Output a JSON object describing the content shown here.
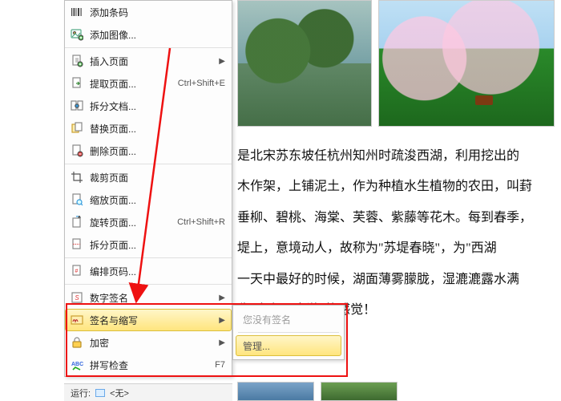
{
  "menu": {
    "items": [
      {
        "label": "添加条码",
        "icon": "barcode-icon"
      },
      {
        "label": "添加图像...",
        "icon": "image-add-icon"
      },
      {
        "sep": true
      },
      {
        "label": "插入页面",
        "icon": "page-insert-icon",
        "submenu": true
      },
      {
        "label": "提取页面...",
        "icon": "page-extract-icon",
        "shortcut": "Ctrl+Shift+E"
      },
      {
        "label": "拆分文档...",
        "icon": "doc-split-icon"
      },
      {
        "label": "替换页面...",
        "icon": "page-replace-icon"
      },
      {
        "label": "删除页面...",
        "icon": "page-delete-icon"
      },
      {
        "sep": true
      },
      {
        "label": "裁剪页面",
        "icon": "crop-icon"
      },
      {
        "label": "缩放页面...",
        "icon": "zoom-page-icon"
      },
      {
        "label": "旋转页面...",
        "icon": "rotate-icon",
        "shortcut": "Ctrl+Shift+R"
      },
      {
        "label": "拆分页面...",
        "icon": "split-page-icon"
      },
      {
        "sep": true
      },
      {
        "label": "编排页码...",
        "icon": "number-pages-icon"
      },
      {
        "sep": true
      },
      {
        "label": "数字签名",
        "icon": "digital-sign-icon",
        "submenu": true
      },
      {
        "label": "签名与缩写",
        "icon": "sign-initials-icon",
        "submenu": true,
        "active": true
      },
      {
        "label": "加密",
        "icon": "encrypt-icon",
        "submenu": true
      },
      {
        "label": "拼写检查",
        "icon": "spellcheck-icon",
        "shortcut": "F7"
      }
    ]
  },
  "submenu": {
    "disabled_label": "您没有签名",
    "manage_label": "管理..."
  },
  "statusbar": {
    "run_label": "运行:",
    "value": "<无>"
  },
  "doc": {
    "lines": [
      "是北宋苏东坡任杭州知州时疏浚西湖，利用挖出的",
      "木作架，上铺泥土，作为种植水生植物的农田，叫葑",
      "垂柳、碧桃、海棠、芙蓉、紫藤等花木。每到春季，",
      "堤上，意境动人，故称为\"苏堤春晓\"，为\"西湖",
      "一天中最好的时候，湖面薄雾朦胧，湿漉漉露水满",
      "称\"人在画中游\"的感觉！"
    ]
  },
  "annotations": {
    "arrow_color": "#e11"
  }
}
